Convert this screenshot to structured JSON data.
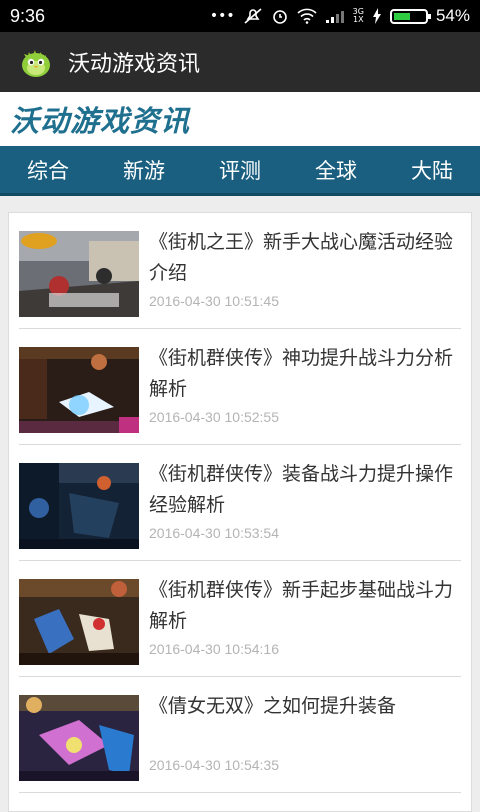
{
  "status": {
    "time": "9:36",
    "network": [
      "3G",
      "1X"
    ],
    "battery_level": 0.54,
    "battery_text": "54%"
  },
  "app": {
    "title": "沃动游戏资讯",
    "logo_icon": "green-bird-icon"
  },
  "brand": {
    "title": "沃动游戏资讯",
    "color": "#1f6f8f"
  },
  "tabs": [
    {
      "label": "综合"
    },
    {
      "label": "新游"
    },
    {
      "label": "评测"
    },
    {
      "label": "全球"
    },
    {
      "label": "大陆"
    }
  ],
  "articles": [
    {
      "title": "《街机之王》新手大战心魔活动经验介绍",
      "date": "2016-04-30 10:51:45"
    },
    {
      "title": "《街机群侠传》神功提升战斗力分析解析",
      "date": "2016-04-30 10:52:55"
    },
    {
      "title": "《街机群侠传》装备战斗力提升操作经验解析",
      "date": "2016-04-30 10:53:54"
    },
    {
      "title": "《街机群侠传》新手起步基础战斗力解析",
      "date": "2016-04-30 10:54:16"
    },
    {
      "title": "《倩女无双》之如何提升装备",
      "date": "2016-04-30 10:54:35"
    }
  ],
  "colors": {
    "tab_bar": "#1a5f7f",
    "app_bar": "#2b2b2b",
    "date_text": "#b4b4b4"
  }
}
